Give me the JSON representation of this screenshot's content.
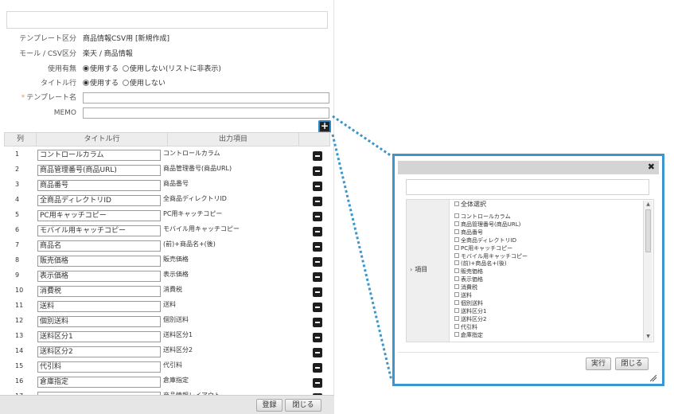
{
  "form": {
    "template_type_label": "テンプレート区分",
    "template_type_value": "商品情報CSV用 [新規作成]",
    "mall_label": "モール / CSV区分",
    "mall_value": "楽天 / 商品情報",
    "enabled_label": "使用有無",
    "enabled_on": "使用する",
    "enabled_off": "使用しない(リストに非表示)",
    "title_row_label": "タイトル行",
    "title_row_on": "使用する",
    "title_row_off": "使用しない",
    "template_name_required_mark": "*",
    "template_name_label": "テンプレート名",
    "memo_label": "MEMO"
  },
  "table": {
    "col_num": "列",
    "col_title": "タイトル行",
    "col_output": "出力項目",
    "rows": [
      {
        "num": "1",
        "title": "コントロールカラム",
        "output": "コントロールカラム"
      },
      {
        "num": "2",
        "title": "商品管理番号(商品URL)",
        "output": "商品管理番号(商品URL)"
      },
      {
        "num": "3",
        "title": "商品番号",
        "output": "商品番号"
      },
      {
        "num": "4",
        "title": "全商品ディレクトリID",
        "output": "全商品ディレクトリID"
      },
      {
        "num": "5",
        "title": "PC用キャッチコピー",
        "output": "PC用キャッチコピー"
      },
      {
        "num": "6",
        "title": "モバイル用キャッチコピー",
        "output": "モバイル用キャッチコピー"
      },
      {
        "num": "7",
        "title": "商品名",
        "output": "(前)+商品名+(後)"
      },
      {
        "num": "8",
        "title": "販売価格",
        "output": "販売価格"
      },
      {
        "num": "9",
        "title": "表示価格",
        "output": "表示価格"
      },
      {
        "num": "10",
        "title": "消費税",
        "output": "消費税"
      },
      {
        "num": "11",
        "title": "送料",
        "output": "送料"
      },
      {
        "num": "12",
        "title": "個別送料",
        "output": "個別送料"
      },
      {
        "num": "13",
        "title": "送料区分1",
        "output": "送料区分1"
      },
      {
        "num": "14",
        "title": "送料区分2",
        "output": "送料区分2"
      },
      {
        "num": "15",
        "title": "代引料",
        "output": "代引料"
      },
      {
        "num": "16",
        "title": "倉庫指定",
        "output": "倉庫指定"
      },
      {
        "num": "17",
        "title": "",
        "output": "商品情報レイアウト"
      }
    ]
  },
  "footer": {
    "register_label": "登録",
    "close_label": "閉じる"
  },
  "dialog": {
    "close_glyph": "✖",
    "row_label": "項目",
    "select_all_label": "全体選択",
    "items": [
      "コントロールカラム",
      "商品管理番号(商品URL)",
      "商品番号",
      "全商品ディレクトリID",
      "PC用キャッチコピー",
      "モバイル用キャッチコピー",
      "(前)+商品名+(後)",
      "販売価格",
      "表示価格",
      "消費税",
      "送料",
      "個別送料",
      "送料区分1",
      "送料区分2",
      "代引料",
      "倉庫指定"
    ],
    "run_label": "実行",
    "close_label": "閉じる"
  },
  "colors": {
    "accent": "#3a96cc",
    "required_mark": "#e0a030"
  },
  "icons": {
    "add": "plus-icon",
    "delete": "minus-icon",
    "close": "close-icon",
    "chevron": "chevron-right-icon"
  }
}
